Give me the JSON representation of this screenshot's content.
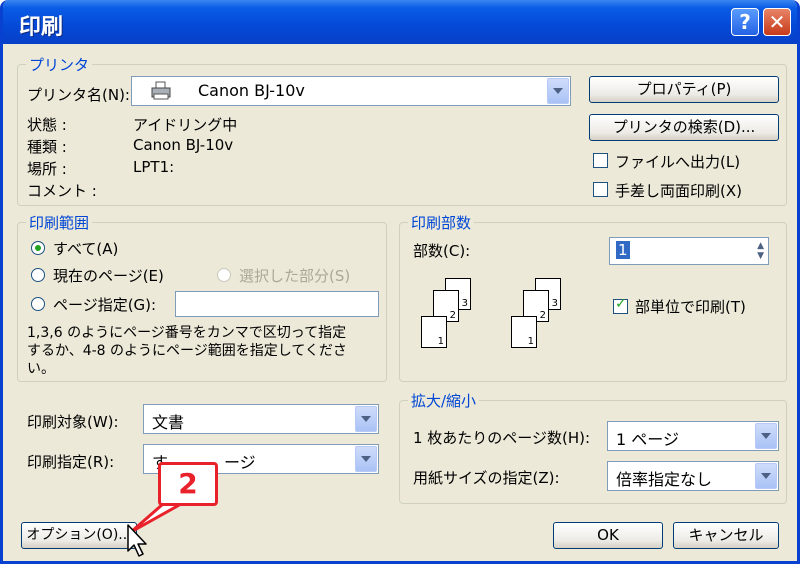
{
  "title": "印刷",
  "title_buttons": {
    "help": "?",
    "close": "✕"
  },
  "printer": {
    "legend": "プリンタ",
    "name_label": "プリンタ名(N):",
    "name_value": "Canon BJ-10v",
    "status_label": "状態 :",
    "status_value": "アイドリング中",
    "type_label": "種類 :",
    "type_value": "Canon BJ-10v",
    "where_label": "場所 :",
    "where_value": "LPT1:",
    "comment_label": "コメント :",
    "properties_button": "プロパティ(P)",
    "find_button": "プリンタの検索(D)...",
    "print_to_file": "ファイルへ出力(L)",
    "manual_duplex": "手差し両面印刷(X)"
  },
  "range": {
    "legend": "印刷範囲",
    "all": "すべて(A)",
    "current": "現在のページ(E)",
    "selection": "選択した部分(S)",
    "pages": "ページ指定(G):",
    "hint_line1": "1,3,6 のようにページ番号をカンマで区切って指定",
    "hint_line2": "するか、4-8 のようにページ範囲を指定してくださ",
    "hint_line3": "い。"
  },
  "copies": {
    "legend": "印刷部数",
    "count_label": "部数(C):",
    "count_value": "1",
    "collate": "部単位で印刷(T)",
    "page_numbers": [
      "1",
      "2",
      "3"
    ]
  },
  "print_what": {
    "label": "印刷対象(W):",
    "value": "文書"
  },
  "print_spec": {
    "label": "印刷指定(R):",
    "value_left": "す",
    "value_right": "ージ"
  },
  "zoom": {
    "legend": "拡大/縮小",
    "pages_per_sheet_label": "1 枚あたりのページ数(H):",
    "pages_per_sheet_value": "1 ページ",
    "scale_label": "用紙サイズの指定(Z):",
    "scale_value": "倍率指定なし"
  },
  "footer": {
    "options_button": "オプション(O)...",
    "ok_button": "OK",
    "cancel_button": "キャンセル"
  },
  "callout_number": "2"
}
